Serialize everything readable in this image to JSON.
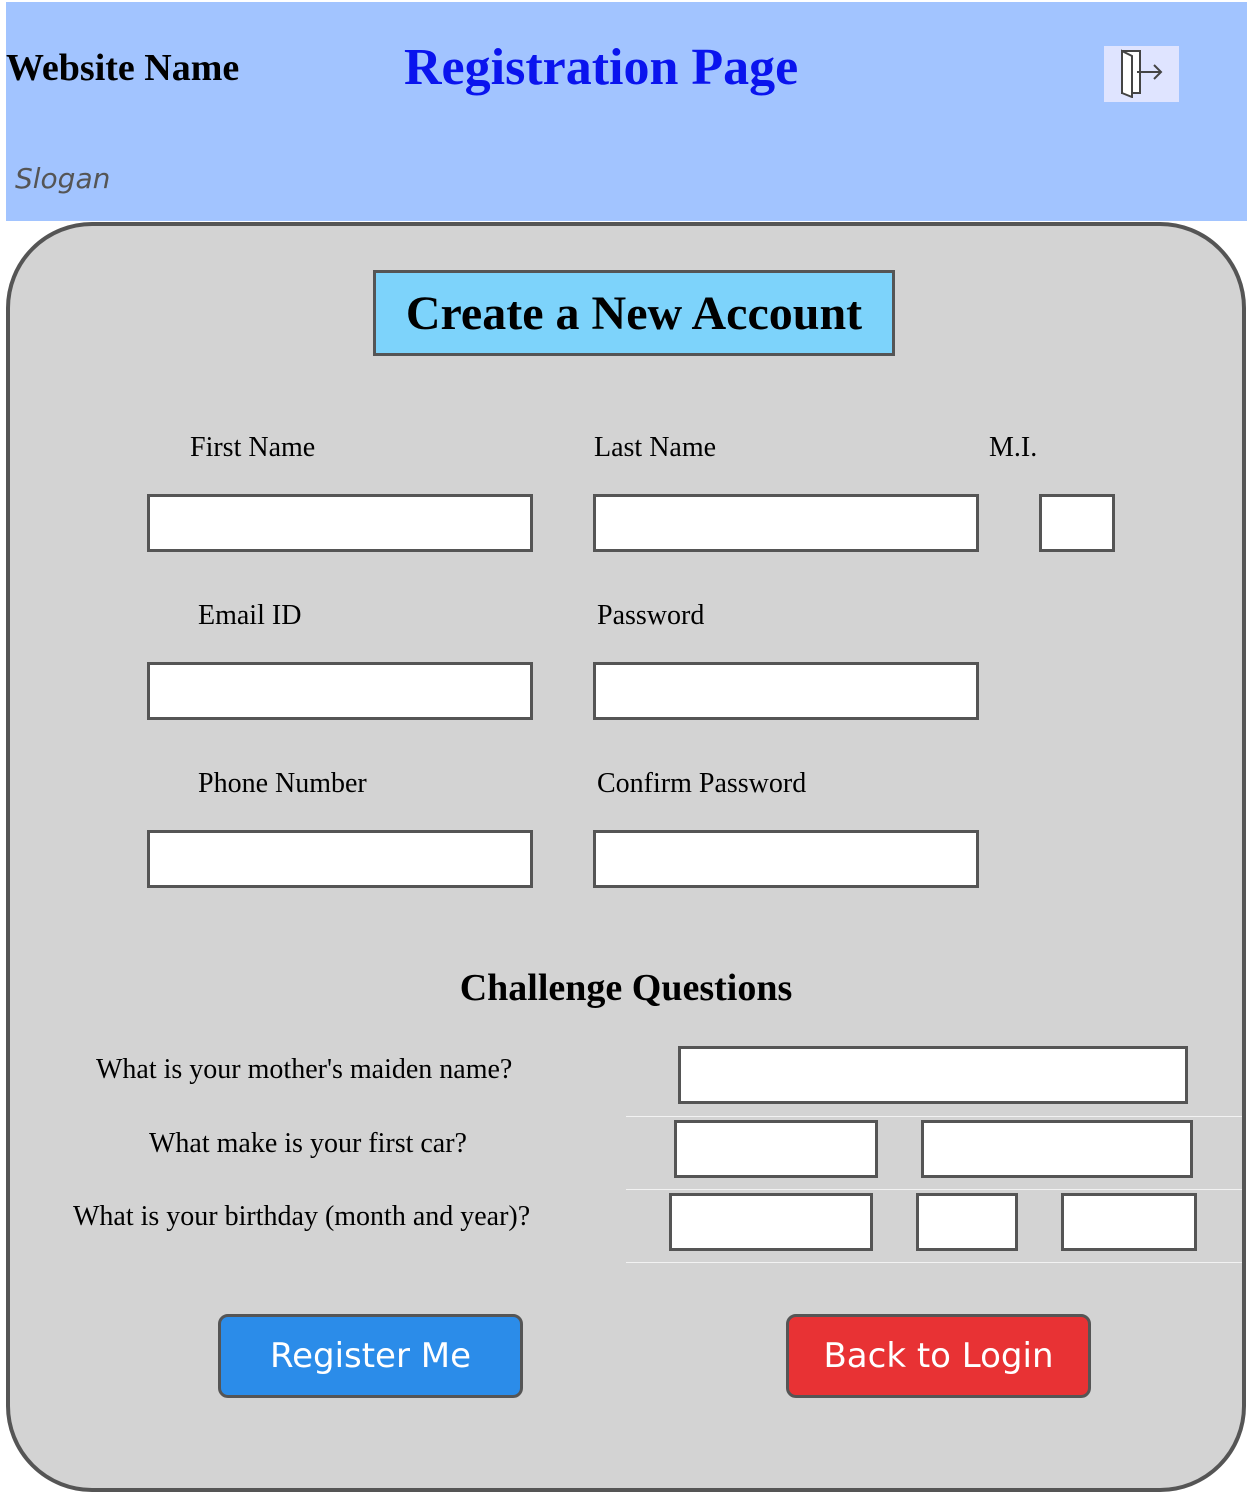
{
  "header": {
    "site_name": "Website Name",
    "page_title": "Registration Page",
    "slogan": "Slogan",
    "logout_icon": "logout-icon"
  },
  "form": {
    "title": "Create a New Account",
    "first_name_label": "First Name",
    "last_name_label": "Last Name",
    "mi_label": "M.I.",
    "email_label": "Email ID",
    "password_label": "Password",
    "phone_label": "Phone Number",
    "confirm_password_label": "Confirm Password",
    "first_name_value": "",
    "last_name_value": "",
    "mi_value": "",
    "email_value": "",
    "password_value": "",
    "phone_value": "",
    "confirm_password_value": ""
  },
  "challenge": {
    "title": "Challenge Questions",
    "q1": "What is your mother's maiden name?",
    "q2": "What make is your first car?",
    "q3": "What is your birthday (month and year)?",
    "q1_value": "",
    "q2_value_a": "",
    "q2_value_b": "",
    "q3_value_a": "",
    "q3_value_b": "",
    "q3_value_c": ""
  },
  "buttons": {
    "register": "Register Me",
    "back": "Back to Login"
  },
  "colors": {
    "header_bg": "#a2c4ff",
    "title_blue": "#0a14ee",
    "panel_bg": "#d3d3d3",
    "form_title_bg": "#7dd3fb",
    "register_bg": "#2b8ce9",
    "back_bg": "#e83234"
  }
}
